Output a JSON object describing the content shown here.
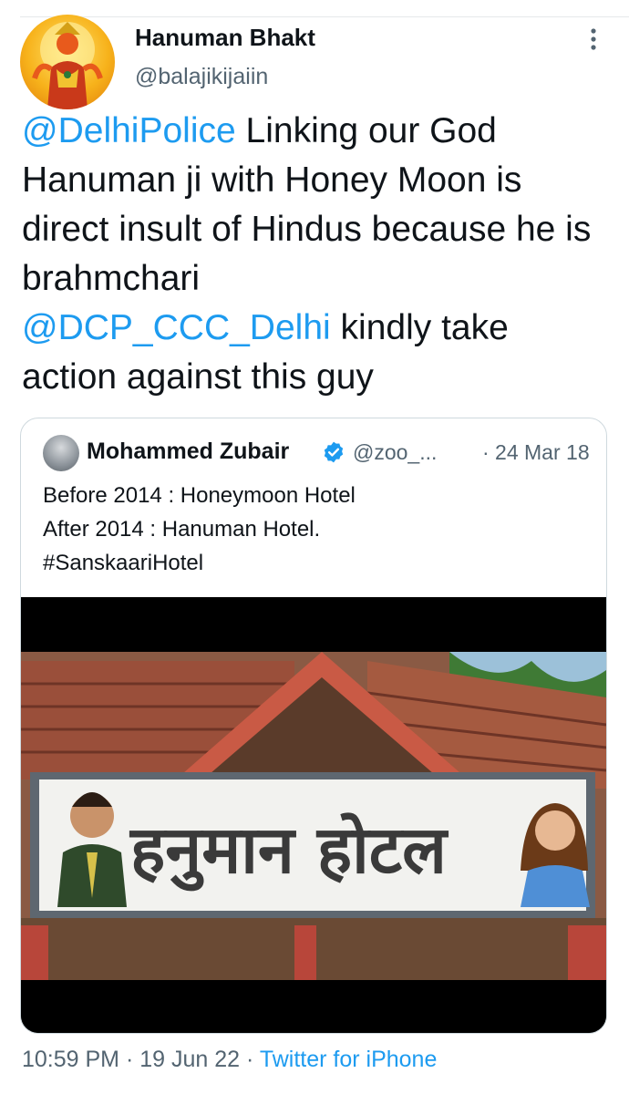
{
  "author": {
    "display_name": "Hanuman Bhakt",
    "handle": "@balajikijaiin",
    "avatar_icon": "hanuman-avatar"
  },
  "tweet": {
    "mention_1": "@DelhiPolice",
    "text_1": " Linking our God Hanuman ji with Honey Moon is direct insult of Hindus  because he is brahmchari",
    "mention_2": "@DCP_CCC_Delhi",
    "text_2": " kindly take action against this guy"
  },
  "quoted_tweet": {
    "display_name": "Mohammed Zubair",
    "handle": "@zoo_...",
    "date": "· 24 Mar 18",
    "lines": [
      "Before 2014 : Honeymoon Hotel",
      "After 2014 : Hanuman Hotel.",
      "#SanskaariHotel"
    ],
    "image": {
      "sign_text": "हनुमान होटल"
    }
  },
  "footer": {
    "time": "10:59 PM",
    "separator": " · ",
    "date": "19 Jun 22",
    "app": "Twitter for iPhone"
  },
  "colors": {
    "link": "#1d9bf0",
    "secondary_text": "#536471",
    "border": "#cfd9de"
  }
}
